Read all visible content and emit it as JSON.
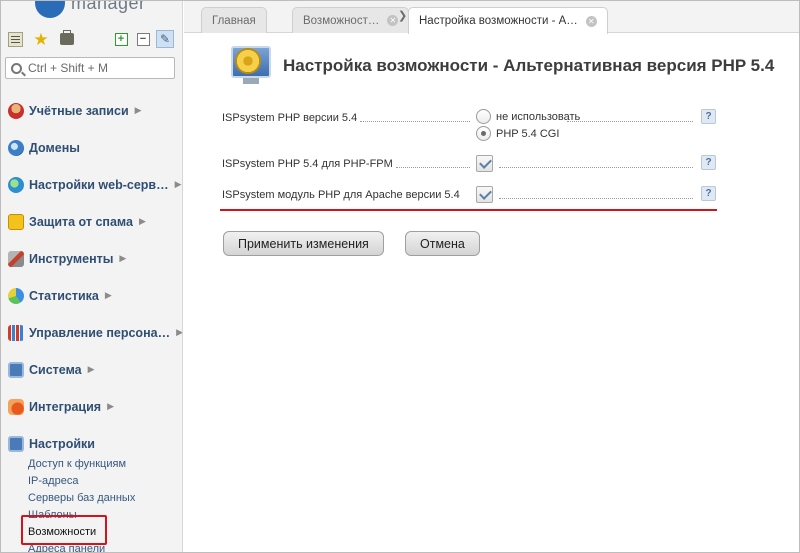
{
  "app": {
    "logo_text": "manager",
    "brand_color": "#2b6cb8"
  },
  "sidebar": {
    "toolbar": {
      "list_icon": "list-icon",
      "favorites_icon": "star-icon",
      "bag_icon": "briefcase-icon",
      "expand_icon": "plus-icon",
      "collapse_icon": "minus-icon",
      "pin_icon": "pin-icon"
    },
    "search": {
      "placeholder": "Ctrl + Shift + M"
    },
    "items": [
      {
        "label": "Учётные записи",
        "arrow": "▶",
        "icon": "users-icon"
      },
      {
        "label": "Домены",
        "arrow": "",
        "icon": "domains-icon"
      },
      {
        "label": "Настройки web-серв…",
        "arrow": "▶",
        "icon": "web-settings-icon"
      },
      {
        "label": "Защита от спама",
        "arrow": "▶",
        "icon": "spam-shield-icon"
      },
      {
        "label": "Инструменты",
        "arrow": "▶",
        "icon": "tools-icon"
      },
      {
        "label": "Статистика",
        "arrow": "▶",
        "icon": "statistics-icon"
      },
      {
        "label": "Управление персона…",
        "arrow": "▶",
        "icon": "staff-icon"
      },
      {
        "label": "Система",
        "arrow": "▶",
        "icon": "system-icon"
      },
      {
        "label": "Интеграция",
        "arrow": "▶",
        "icon": "integration-icon"
      },
      {
        "label": "Настройки",
        "arrow": "",
        "icon": "settings-icon"
      }
    ],
    "subitems": [
      "Доступ к функциям",
      "IP-адреса",
      "Серверы баз данных",
      "Шаблоны",
      "Возможности",
      "Адреса панели"
    ],
    "current_subitem": "Возможности"
  },
  "tabs": [
    {
      "label": "Главная",
      "closable": false
    },
    {
      "label": "Возможност…",
      "closable": true
    },
    {
      "label": "Настройка возможности - А…",
      "closable": true
    }
  ],
  "tab_separator": "❯",
  "page": {
    "title": "Настройка возможности - Альтернативная версия PHP 5.4",
    "icon": "monitor-gear-icon"
  },
  "form": {
    "rows": [
      {
        "label": "ISPsystem PHP версии 5.4",
        "type": "radio",
        "options": [
          {
            "label": "не использовать",
            "selected": false
          },
          {
            "label": "PHP 5.4 CGI",
            "selected": true
          }
        ]
      },
      {
        "label": "ISPsystem PHP 5.4 для PHP-FPM",
        "type": "checkbox",
        "checked": true
      },
      {
        "label": "ISPsystem модуль PHP для Apache версии 5.4",
        "type": "checkbox",
        "checked": true
      }
    ],
    "help_symbol": "?"
  },
  "buttons": {
    "apply": "Применить изменения",
    "cancel": "Отмена"
  },
  "colors": {
    "nav_text": "#2f4e72",
    "highlight_red": "#d4141c",
    "sidebar_bg": "#f3f3f3"
  }
}
